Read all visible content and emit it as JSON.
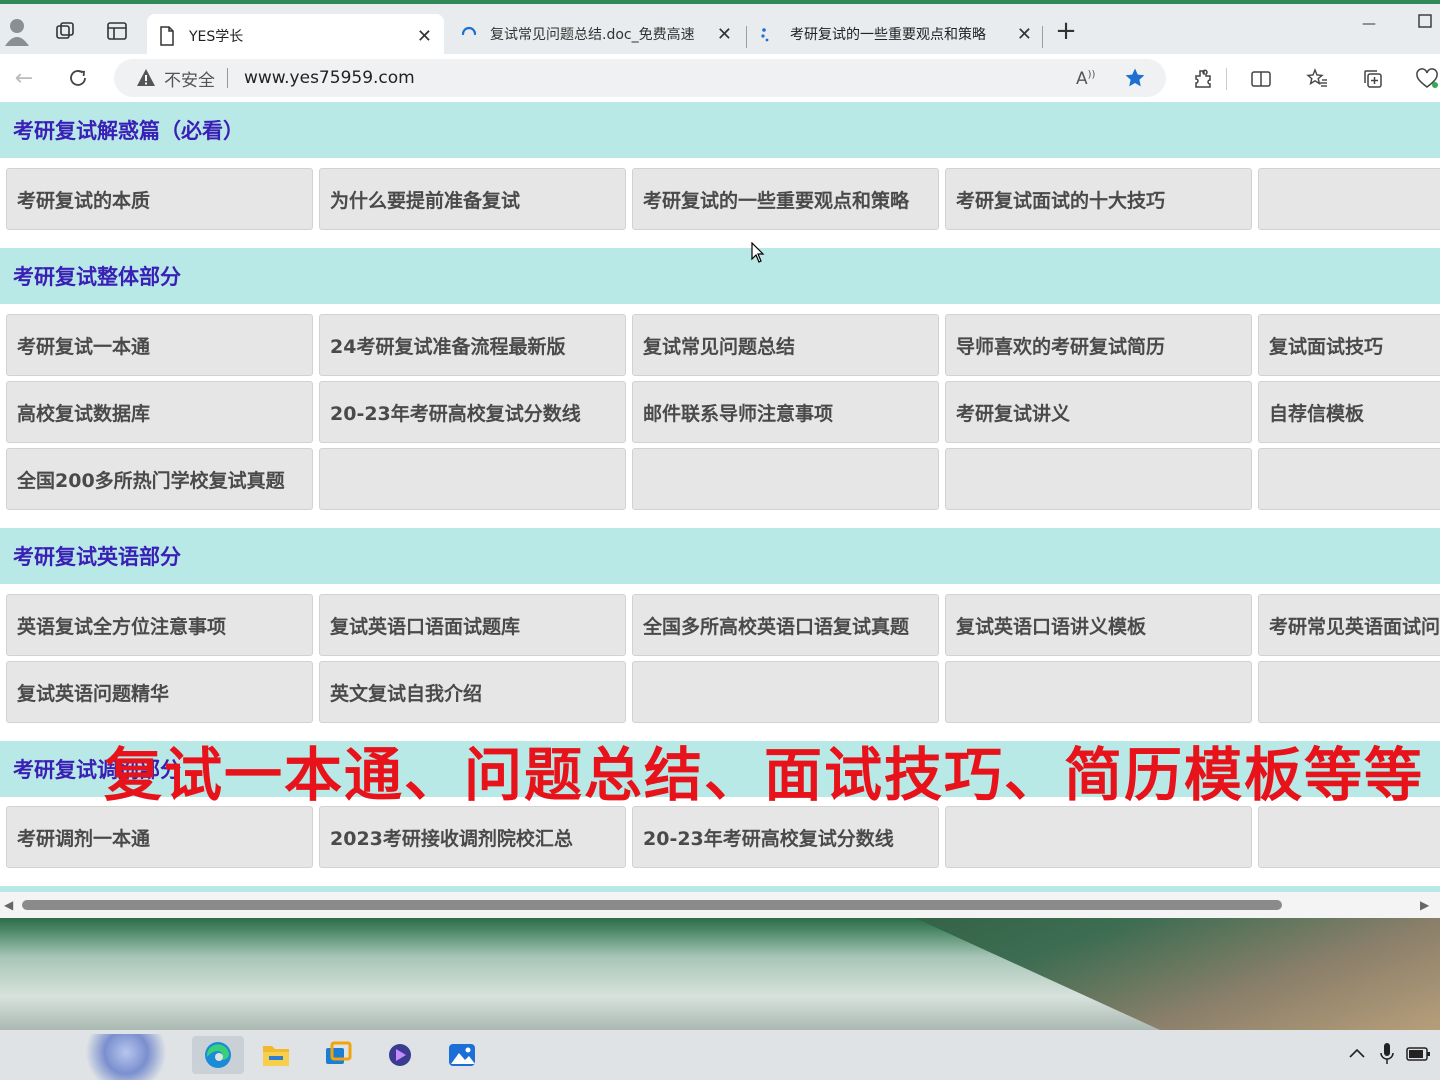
{
  "browser": {
    "tabs": [
      {
        "title": "YES学长",
        "active": true
      },
      {
        "title": "复试常见问题总结.doc_免费高速",
        "loading": true
      },
      {
        "title": "考研复试的一些重要观点和策略"
      }
    ],
    "security_label": "不安全",
    "url": "www.yes75959.com"
  },
  "sections": [
    {
      "title": "考研复试解惑篇（必看）",
      "items": [
        "考研复试的本质",
        "为什么要提前准备复试",
        "考研复试的一些重要观点和策略",
        "考研复试面试的十大技巧",
        ""
      ]
    },
    {
      "title": "考研复试整体部分",
      "items": [
        "考研复试一本通",
        "24考研复试准备流程最新版",
        "复试常见问题总结",
        "导师喜欢的考研复试简历",
        "复试面试技巧",
        "高校复试数据库",
        "20-23年考研高校复试分数线",
        "邮件联系导师注意事项",
        "考研复试讲义",
        "自荐信模板",
        "全国200多所热门学校复试真题",
        "",
        "",
        "",
        ""
      ]
    },
    {
      "title": "考研复试英语部分",
      "items": [
        "英语复试全方位注意事项",
        "复试英语口语面试题库",
        "全国多所高校英语口语复试真题",
        "复试英语口语讲义模板",
        "考研常见英语面试问",
        "复试英语问题精华",
        "英文复试自我介绍",
        "",
        "",
        ""
      ]
    },
    {
      "title": "考研复试调剂部分",
      "items": [
        "考研调剂一本通",
        "2023考研接收调剂院校汇总",
        "20-23年考研高校复试分数线",
        "",
        ""
      ]
    }
  ],
  "overlay_caption": "复试一本通、问题总结、面试技巧、简历模板等等",
  "colors": {
    "section_bg": "#b9e9e7",
    "section_title": "#3a1fb6",
    "cell_bg": "#e6e6e6",
    "overlay_red": "#e8121a"
  }
}
